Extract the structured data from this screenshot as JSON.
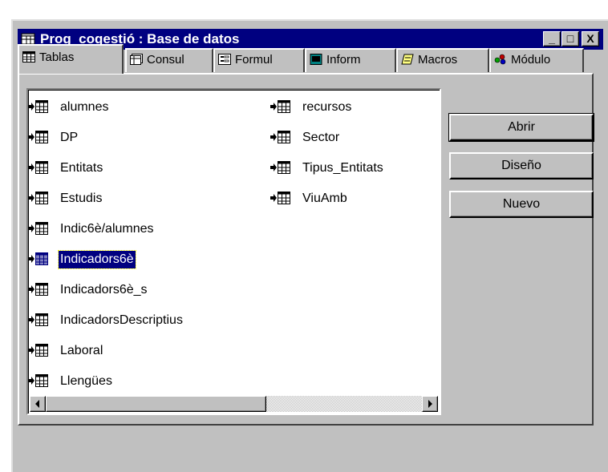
{
  "window": {
    "title": "Prog_cogestió : Base de datos",
    "minimize_label": "_",
    "maximize_label": "□",
    "close_label": "X"
  },
  "tabs": [
    {
      "label": "Tablas",
      "icon": "table-icon"
    },
    {
      "label": "Consul",
      "icon": "query-icon"
    },
    {
      "label": "Formul",
      "icon": "form-icon"
    },
    {
      "label": "Inform",
      "icon": "report-icon"
    },
    {
      "label": "Macros",
      "icon": "macro-icon"
    },
    {
      "label": "Módulo",
      "icon": "module-icon"
    }
  ],
  "tables": {
    "column1": [
      "alumnes",
      "DP",
      "Entitats",
      "Estudis",
      "Indic6è/alumnes",
      "Indicadors6è",
      "Indicadors6è_s",
      "IndicadorsDescriptius",
      "Laboral",
      "Llengües"
    ],
    "column2": [
      "recursos",
      "Sector",
      "Tipus_Entitats",
      "ViuAmb"
    ],
    "selected": "Indicadors6è"
  },
  "buttons": {
    "open": "Abrir",
    "design": "Diseño",
    "new": "Nuevo"
  },
  "colors": {
    "titlebar": "#000080",
    "selection": "#000080",
    "face": "#c0c0c0"
  }
}
